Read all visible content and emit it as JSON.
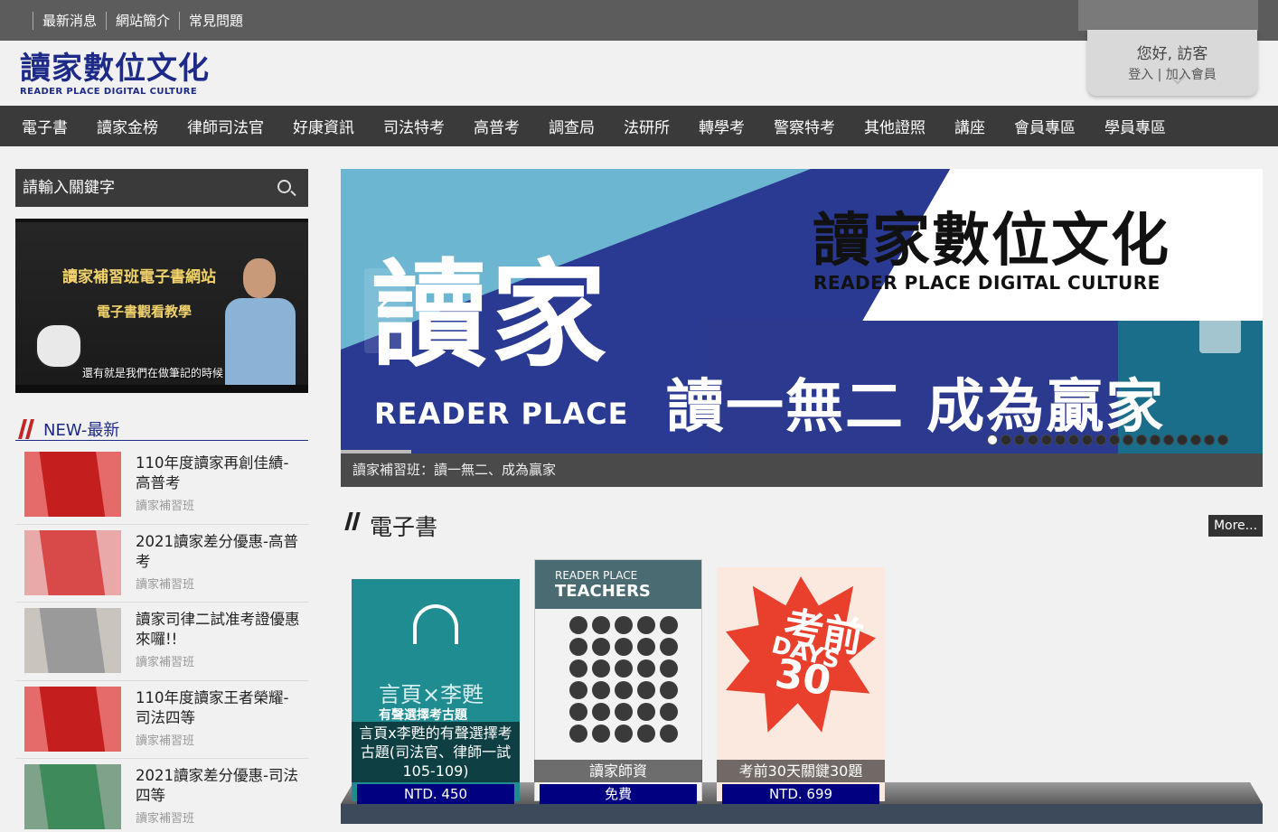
{
  "top_links": [
    "最新消息",
    "網站簡介",
    "常見問題"
  ],
  "logo": {
    "cn": "讀家數位文化",
    "en": "READER PLACE DIGITAL CULTURE"
  },
  "user": {
    "greeting": "您好, 訪客",
    "login": "登入 | 加入會員"
  },
  "nav": [
    "電子書",
    "讀家金榜",
    "律師司法官",
    "好康資訊",
    "司法特考",
    "高普考",
    "調查局",
    "法研所",
    "轉學考",
    "警察特考",
    "其他證照",
    "講座",
    "會員專區",
    "學員專區"
  ],
  "search": {
    "placeholder": "請輸入關鍵字"
  },
  "video": {
    "line1": "讀家補習班電子書網站",
    "line2": "電子書觀看教學",
    "subtitle": "還有就是我們在做筆記的時候"
  },
  "news": {
    "title": "NEW-最新",
    "items": [
      {
        "title": "110年度讀家再創佳績-高普考",
        "source": "讀家補習班"
      },
      {
        "title": "2021讀家差分優惠-高普考",
        "source": "讀家補習班"
      },
      {
        "title": "讀家司律二試准考證優惠來囉!!",
        "source": "讀家補習班"
      },
      {
        "title": "110年度讀家王者榮耀-司法四等",
        "source": "讀家補習班"
      },
      {
        "title": "2021讀家差分優惠-司法四等",
        "source": "讀家補習班"
      }
    ]
  },
  "banner": {
    "logo_cn": "讀家數位文化",
    "logo_en": "READER PLACE DIGITAL CULTURE",
    "big_cn": "讀家",
    "big_en": "READER PLACE",
    "slogan": "讀一無二 成為贏家",
    "caption": "讀家補習班：讀一無二、成為贏家",
    "slide_count": 18,
    "active_slide": 1
  },
  "ebooks": {
    "title": "電子書",
    "more": "More...",
    "books": [
      {
        "label": "言頁x李甦的有聲選擇考古題(司法官、律師一試105-109)",
        "price": "NTD. 450",
        "cover_title": "言頁×李甦",
        "cover_sub": "有聲選擇考古題"
      },
      {
        "label": "讀家師資",
        "price": "免費",
        "cover_en1": "READER PLACE",
        "cover_en2": "TEACHERS"
      },
      {
        "label": "考前30天關鍵30題",
        "price": "NTD. 699",
        "cover_num": "考前30",
        "cover_days": "DAYS"
      }
    ]
  }
}
